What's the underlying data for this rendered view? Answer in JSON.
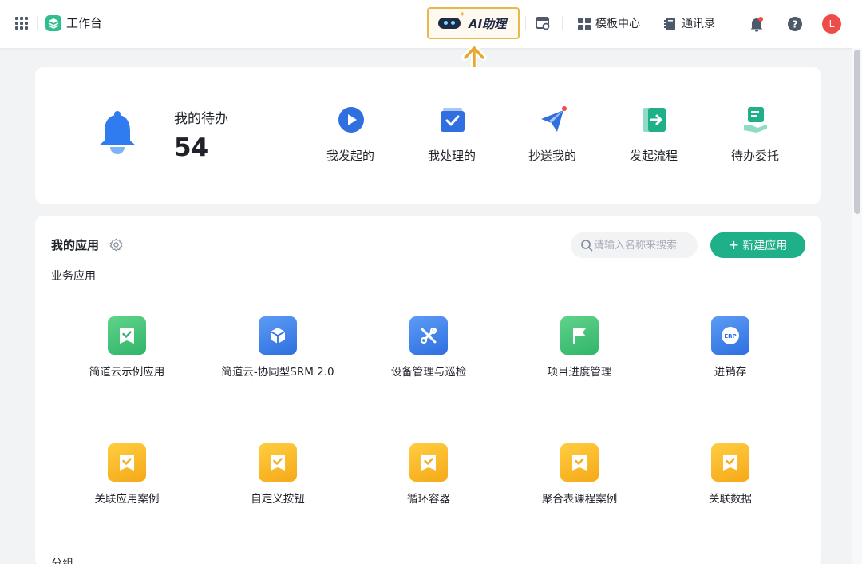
{
  "topbar": {
    "brand": "工作台",
    "ai_assistant": "AI助理",
    "nav": [
      {
        "label": "模板中心",
        "icon": "template-grid-icon"
      },
      {
        "label": "通讯录",
        "icon": "contacts-book-icon"
      }
    ],
    "avatar_initial": "L"
  },
  "todo": {
    "title": "我的待办",
    "count": "54",
    "quick_actions": [
      {
        "label": "我发起的",
        "icon": "play-circle-icon",
        "color": "#2f6fe0"
      },
      {
        "label": "我处理的",
        "icon": "check-box-icon",
        "color": "#2f6fe0"
      },
      {
        "label": "抄送我的",
        "icon": "paper-plane-icon",
        "color": "#2f6fe0"
      },
      {
        "label": "发起流程",
        "icon": "enter-arrow-icon",
        "color": "#1fb08a"
      },
      {
        "label": "待办委托",
        "icon": "hand-document-icon",
        "color": "#1fb08a"
      }
    ]
  },
  "apps": {
    "title": "我的应用",
    "search_placeholder": "请输入名称来搜索",
    "new_button": "新建应用",
    "section_label": "业务应用",
    "group_label": "分组",
    "items": [
      {
        "label": "简道云示例应用",
        "icon": "badge-check-icon",
        "color": "green"
      },
      {
        "label": "简道云-协同型SRM 2.0",
        "icon": "cube-icon",
        "color": "blue"
      },
      {
        "label": "设备管理与巡检",
        "icon": "tools-icon",
        "color": "blue"
      },
      {
        "label": "项目进度管理",
        "icon": "flag-icon",
        "color": "green"
      },
      {
        "label": "进销存",
        "icon": "erp-icon",
        "color": "blue",
        "badge_text": "ERP"
      },
      {
        "label": "关联应用案例",
        "icon": "badge-check-icon",
        "color": "yellow"
      },
      {
        "label": "自定义按钮",
        "icon": "badge-check-icon",
        "color": "yellow"
      },
      {
        "label": "循环容器",
        "icon": "badge-check-icon",
        "color": "yellow"
      },
      {
        "label": "聚合表课程案例",
        "icon": "badge-check-icon",
        "color": "yellow"
      },
      {
        "label": "关联数据",
        "icon": "badge-check-icon",
        "color": "yellow"
      }
    ]
  },
  "colors": {
    "accent_green": "#1fb08a",
    "accent_blue": "#2f6fe0",
    "highlight": "#e8b84c",
    "avatar": "#ee4c48"
  }
}
